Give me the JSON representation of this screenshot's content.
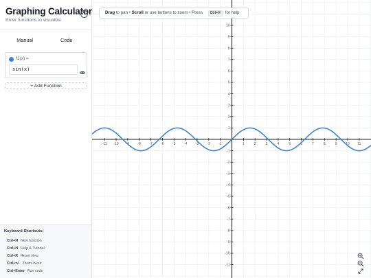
{
  "app": {
    "title": "Graphing Calculator",
    "subtitle": "Enter functions to visualize",
    "help_glyph": "?"
  },
  "tabs": [
    {
      "label": "Manual",
      "active": true
    },
    {
      "label": "Code",
      "active": false
    }
  ],
  "functions": [
    {
      "name": "f1(x) =",
      "expression": "sin(x)",
      "color": "#3d83d6",
      "visible": true
    }
  ],
  "add_function_label": "+ Add Function",
  "toolbar": {
    "drag": "Drag",
    "to_pan": " to pan • ",
    "scroll": "Scroll",
    "zoom_text": " or use buttons to zoom • Press ",
    "key": "Ctrl+H",
    "help_text": "for help"
  },
  "shortcuts": {
    "title": "Keyboard Shortcuts:",
    "items": [
      {
        "key": "Ctrl+N",
        "action": "New function"
      },
      {
        "key": "Ctrl+H",
        "action": "Help & Tutorial"
      },
      {
        "key": "Ctrl+R",
        "action": "Reset view"
      },
      {
        "key": "Ctrl+=/-",
        "action": "Zoom in/out"
      },
      {
        "key": "Ctrl+Enter",
        "action": "Run code"
      }
    ]
  },
  "zoom_controls": [
    "zoom-in-icon",
    "zoom-out-icon",
    "fit-view-icon"
  ],
  "chart_data": {
    "type": "line",
    "function": "sin(x)",
    "series": [
      {
        "values": "sin(x)",
        "color": "#3d83d6"
      }
    ],
    "xlim": [
      -12,
      12.2
    ],
    "ylim": [
      -12.2,
      12.2
    ],
    "x_ticks": [
      -11,
      -10,
      -9,
      -8,
      -7,
      -6,
      -5,
      -4,
      -3,
      -2,
      -1,
      1,
      2,
      3,
      4,
      5,
      6,
      7,
      8,
      9,
      10,
      11
    ],
    "y_ticks": [
      -11,
      -10,
      -9,
      -8,
      -7,
      -6,
      -5,
      -4,
      -3,
      -2,
      -1,
      1,
      2,
      3,
      4,
      5,
      6,
      7,
      8,
      9,
      10
    ],
    "grid": true
  }
}
